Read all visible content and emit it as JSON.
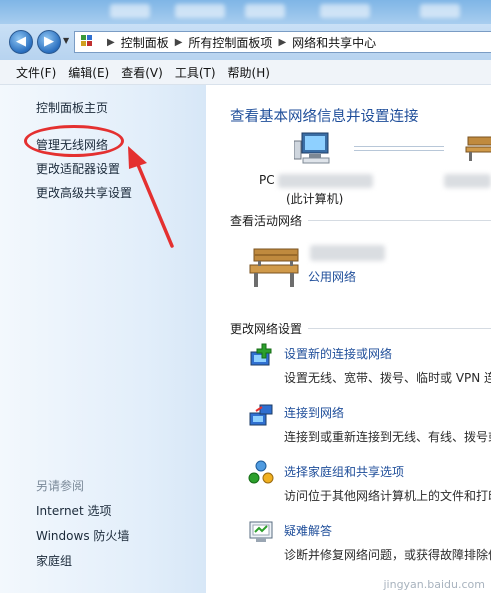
{
  "address": {
    "crumbs": [
      "控制面板",
      "所有控制面板项",
      "网络和共享中心"
    ]
  },
  "menu": [
    "文件(F)",
    "编辑(E)",
    "查看(V)",
    "工具(T)",
    "帮助(H)"
  ],
  "sidebar": {
    "home": "控制面板主页",
    "items": [
      "管理无线网络",
      "更改适配器设置",
      "更改高级共享设置"
    ],
    "see_also_header": "另请参阅",
    "see_also": [
      "Internet 选项",
      "Windows 防火墙",
      "家庭组"
    ]
  },
  "main": {
    "title": "查看基本网络信息并设置连接",
    "computer_name_prefix": "PC",
    "computer_caption": "(此计算机)",
    "active_section": "查看活动网络",
    "network_type_link": "公用网络",
    "change_section": "更改网络设置",
    "tasks": [
      {
        "link": "设置新的连接或网络",
        "desc": "设置无线、宽带、拨号、临时或 VPN 连"
      },
      {
        "link": "连接到网络",
        "desc": "连接到或重新连接到无线、有线、拨号或 V"
      },
      {
        "link": "选择家庭组和共享选项",
        "desc": "访问位于其他网络计算机上的文件和打印"
      },
      {
        "link": "疑难解答",
        "desc": "诊断并修复网络问题，或获得故障排除信"
      }
    ]
  },
  "watermark": "jingyan.baidu.com",
  "colors": {
    "annotation": "#e43030",
    "link": "#1f4e9a"
  }
}
